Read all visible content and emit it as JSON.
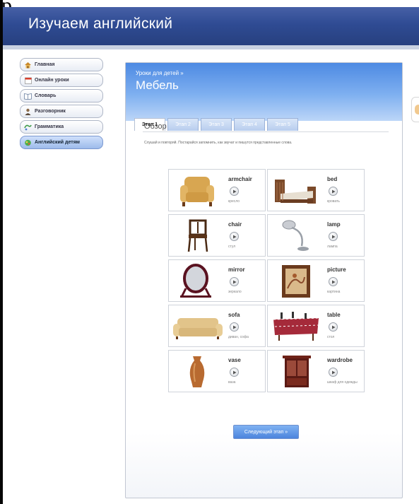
{
  "top_glyph": "р",
  "header": {
    "title": "Изучаем английский"
  },
  "nav": [
    {
      "label": "Главная",
      "icon": "home-icon",
      "active": false
    },
    {
      "label": "Онлайн уроки",
      "icon": "calendar-icon",
      "active": false
    },
    {
      "label": "Словарь",
      "icon": "book-icon",
      "active": false
    },
    {
      "label": "Разговорник",
      "icon": "people-icon",
      "active": false
    },
    {
      "label": "Грамматика",
      "icon": "grammar-icon",
      "active": false
    },
    {
      "label": "Английский детям",
      "icon": "kids-icon",
      "active": true
    }
  ],
  "lesson": {
    "breadcrumb": "Уроки для детей »",
    "title": "Мебель",
    "tabs": [
      {
        "label": "Этап 1",
        "active": true
      },
      {
        "label": "Этап 2",
        "active": false
      },
      {
        "label": "Этап 3",
        "active": false
      },
      {
        "label": "Этап 4",
        "active": false
      },
      {
        "label": "Этап 5",
        "active": false
      }
    ],
    "section_title": "Обзор",
    "instructions": "Слушай и повторяй. Постарайся запомнить, как звучат и пишутся представленные слова.",
    "cards": [
      {
        "word": "armchair",
        "translation": "кресло",
        "icon": "armchair-image"
      },
      {
        "word": "bed",
        "translation": "кровать",
        "icon": "bed-image"
      },
      {
        "word": "chair",
        "translation": "стул",
        "icon": "chair-image"
      },
      {
        "word": "lamp",
        "translation": "лампа",
        "icon": "lamp-image"
      },
      {
        "word": "mirror",
        "translation": "зеркало",
        "icon": "mirror-image"
      },
      {
        "word": "picture",
        "translation": "картина",
        "icon": "picture-image"
      },
      {
        "word": "sofa",
        "translation": "диван, софа",
        "icon": "sofa-image"
      },
      {
        "word": "table",
        "translation": "стол",
        "icon": "table-image"
      },
      {
        "word": "vase",
        "translation": "ваза",
        "icon": "vase-image"
      },
      {
        "word": "wardrobe",
        "translation": "шкаф для одежды",
        "icon": "wardrobe-image"
      }
    ],
    "next_button": "Следующий этап »"
  },
  "colors": {
    "header": "#2f4b93",
    "panel_head": "#5b96e6",
    "button": "#4c84dd"
  }
}
